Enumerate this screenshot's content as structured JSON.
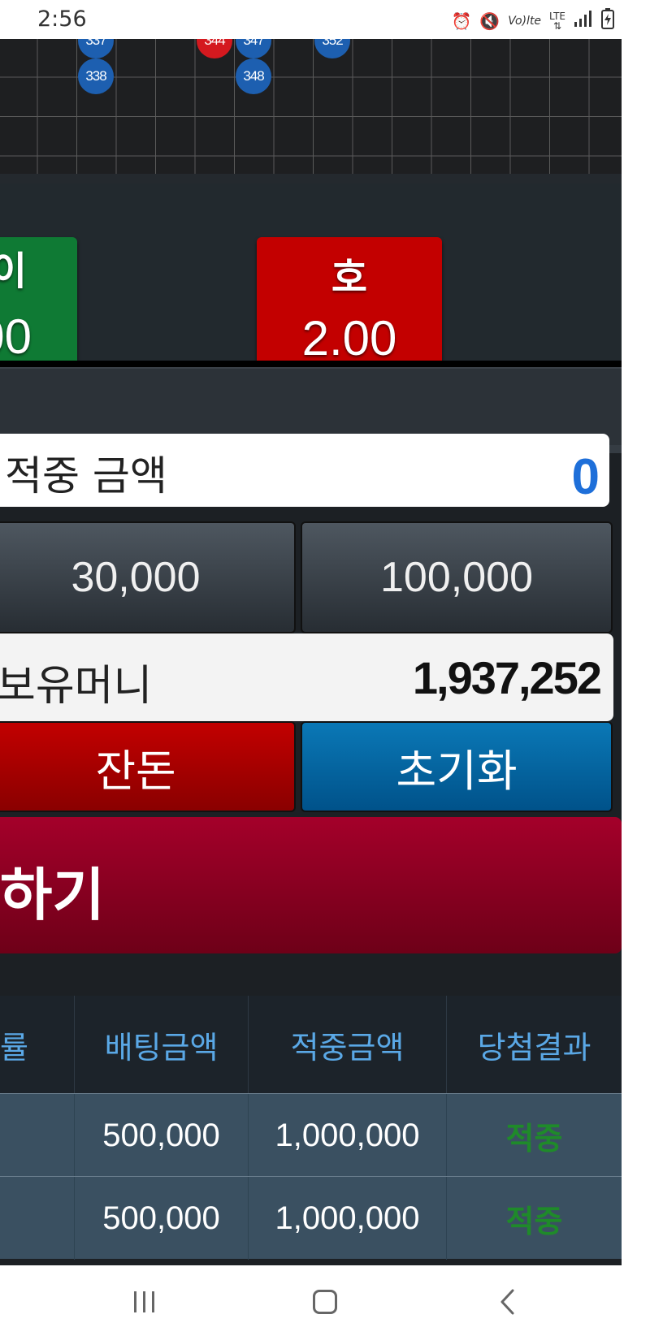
{
  "status_bar": {
    "time": "2:56",
    "icons": [
      "alarm-icon",
      "mute-icon",
      "volte-icon",
      "lte-icon",
      "signal-icon",
      "battery-charging-icon"
    ],
    "volte_text": "Vo)lte",
    "lte_text": "LTE"
  },
  "board": {
    "beads": [
      {
        "label": "337",
        "color": "blue"
      },
      {
        "label": "344",
        "color": "red"
      },
      {
        "label": "347",
        "color": "blue"
      },
      {
        "label": "352",
        "color": "blue"
      },
      {
        "label": "338",
        "color": "blue"
      },
      {
        "label": "348",
        "color": "blue"
      }
    ]
  },
  "bets": {
    "left": {
      "name": "이",
      "odds": "00",
      "color": "#0f7a34"
    },
    "right": {
      "name": "호",
      "odds": "2.00",
      "color": "#c30000"
    }
  },
  "amount": {
    "label": "적중 금액",
    "value": "0"
  },
  "chips": {
    "chip_a": "30,000",
    "chip_b": "100,000"
  },
  "balance": {
    "label": "보유머니",
    "value": "1,937,252"
  },
  "actions": {
    "change": "잔돈",
    "reset": "초기화"
  },
  "big_button": {
    "label": "하기"
  },
  "table": {
    "headers": [
      "률",
      "배팅금액",
      "적중금액",
      "당첨결과"
    ],
    "rows": [
      {
        "odds": "",
        "bet": "500,000",
        "win": "1,000,000",
        "result": "적중"
      },
      {
        "odds": "",
        "bet": "500,000",
        "win": "1,000,000",
        "result": "적중"
      }
    ]
  },
  "colors": {
    "accent_blue": "#1e6fd9",
    "header_text": "#5aa8e6",
    "win_green": "#1f8a2a"
  },
  "nav_bar": {
    "icons": [
      "recent-apps-icon",
      "home-icon",
      "back-icon"
    ]
  }
}
